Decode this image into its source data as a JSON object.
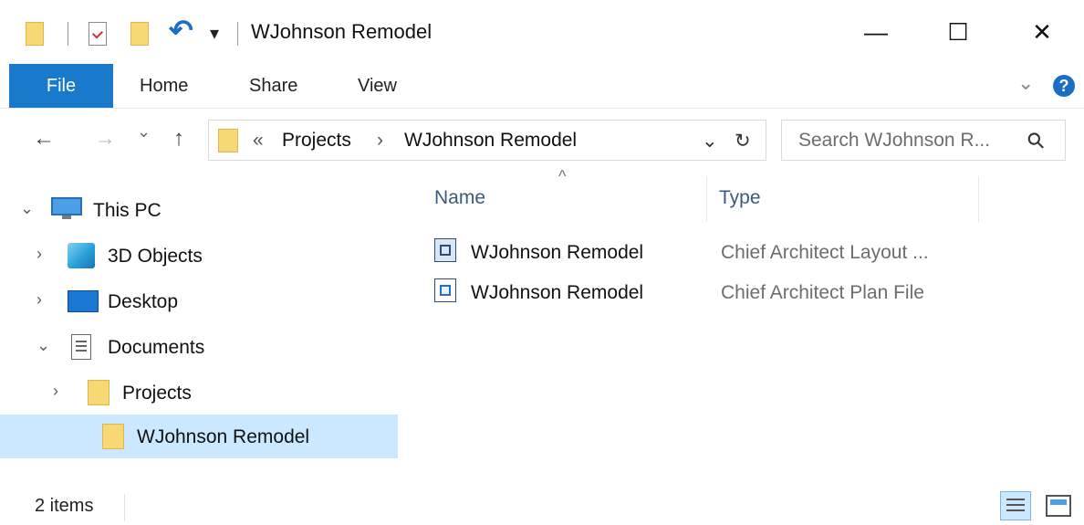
{
  "window": {
    "title": "WJohnson Remodel",
    "minimize_glyph": "—",
    "maximize_glyph": "☐",
    "close_glyph": "✕",
    "undo_glyph": "↶",
    "qat_dropdown_glyph": "▾"
  },
  "ribbon": {
    "tabs": [
      {
        "label": "File",
        "active": true
      },
      {
        "label": "Home"
      },
      {
        "label": "Share"
      },
      {
        "label": "View"
      }
    ],
    "expand_glyph": "⌄",
    "help_glyph": "?"
  },
  "nav": {
    "back_glyph": "←",
    "forward_glyph": "→",
    "recent_glyph": "⌄",
    "up_glyph": "↑"
  },
  "address": {
    "overflow_glyph": "«",
    "separator_glyph": "›",
    "crumbs": [
      "Projects",
      "WJohnson Remodel"
    ],
    "dropdown_glyph": "⌄",
    "refresh_glyph": "↻"
  },
  "search": {
    "placeholder": "Search WJohnson R...",
    "icon_glyph": "⚲"
  },
  "tree": {
    "items": [
      {
        "label": "This PC",
        "expand": "⌄",
        "icon": "computer-icon"
      },
      {
        "label": "3D Objects",
        "expand": "›",
        "icon": "cube-icon"
      },
      {
        "label": "Desktop",
        "expand": "›",
        "icon": "desktop-icon"
      },
      {
        "label": "Documents",
        "expand": "⌄",
        "icon": "document-icon"
      },
      {
        "label": "Projects",
        "expand": "›",
        "icon": "folder-icon"
      },
      {
        "label": "WJohnson Remodel",
        "expand": "",
        "icon": "folder-icon",
        "selected": true
      }
    ]
  },
  "columns": {
    "name": "Name",
    "type": "Type",
    "sort_glyph": "^"
  },
  "files": [
    {
      "name": "WJohnson Remodel",
      "type": "Chief Architect Layout ...",
      "icon": "layout-file-icon"
    },
    {
      "name": "WJohnson Remodel",
      "type": "Chief Architect Plan File",
      "icon": "plan-file-icon"
    }
  ],
  "status": {
    "item_count": "2 items"
  },
  "colors": {
    "accent": "#1979ca",
    "selection": "#cce8ff",
    "folder": "#f8d775"
  }
}
